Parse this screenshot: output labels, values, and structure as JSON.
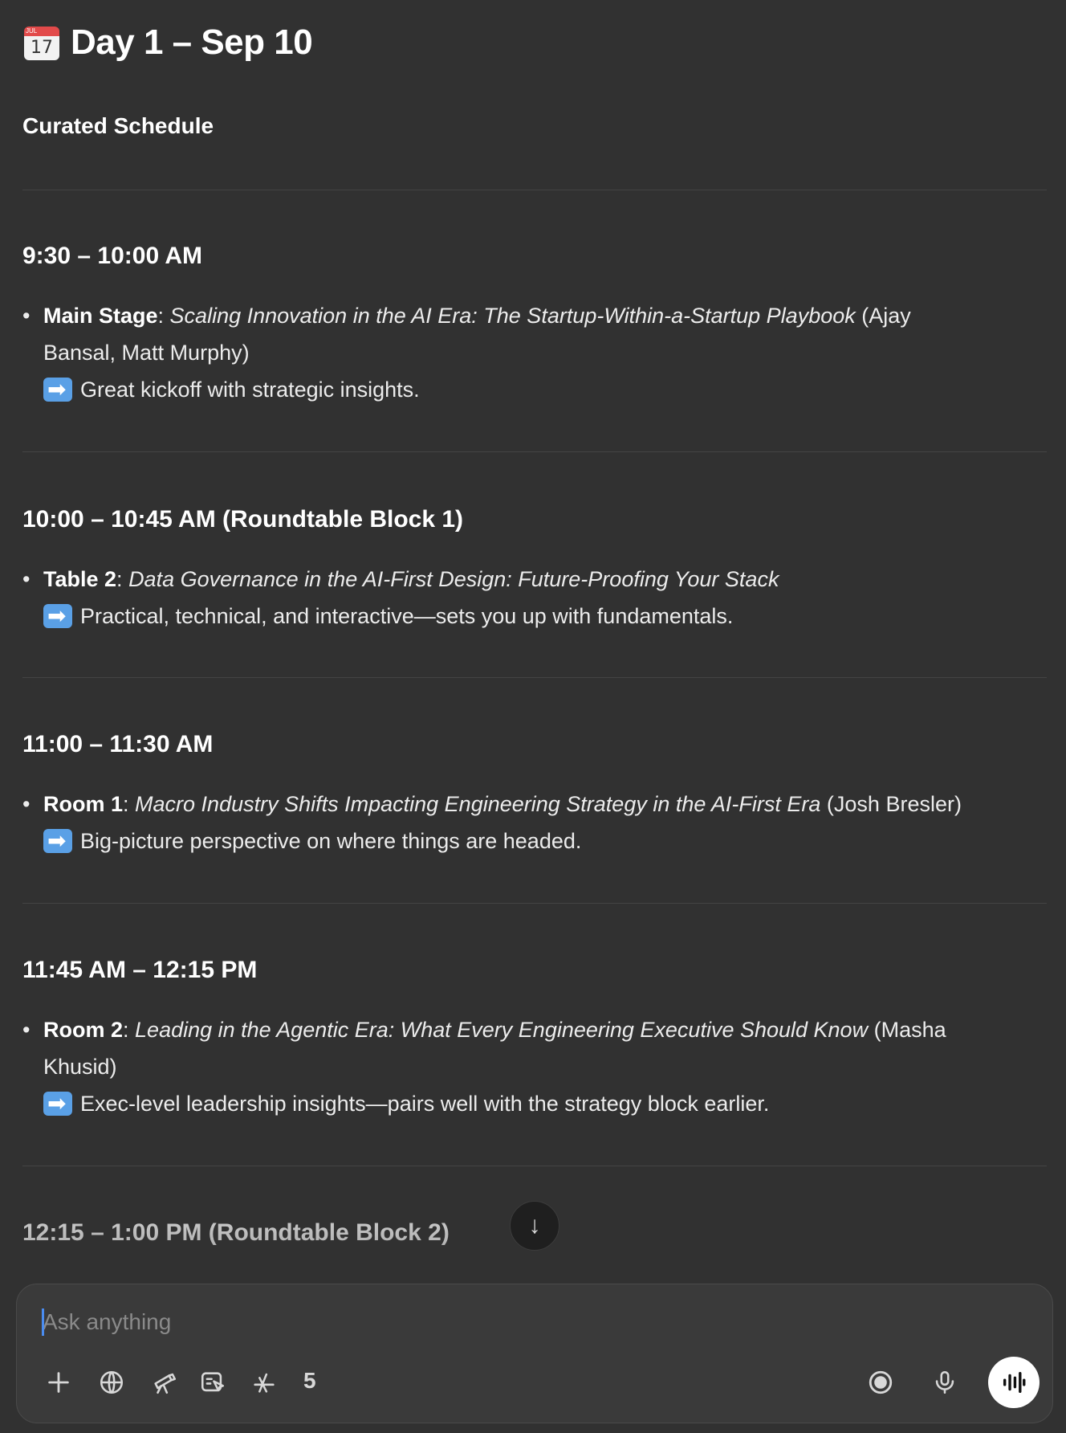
{
  "header": {
    "icon": "calendar-icon",
    "calendar_icon_day": "17",
    "calendar_icon_month": "JUL",
    "title": "Day 1 – Sep 10",
    "subtitle": "Curated Schedule"
  },
  "sessions": [
    {
      "time": "9:30 – 10:00 AM",
      "location": "Main Stage",
      "talk": "Scaling Innovation in the AI Era: The Startup-Within-a-Startup Playbook",
      "speakers_line1": "(Ajay",
      "speakers_line2": "Bansal, Matt Murphy)",
      "note": "Great kickoff with strategic insights."
    },
    {
      "time": "10:00 – 10:45 AM (Roundtable Block 1)",
      "location": "Table 2",
      "talk": "Data Governance in the AI-First Design: Future-Proofing Your Stack",
      "note": "Practical, technical, and interactive—sets you up with fundamentals."
    },
    {
      "time": "11:00 – 11:30 AM",
      "location": "Room 1",
      "talk": "Macro Industry Shifts Impacting Engineering Strategy in the AI-First Era",
      "speakers": "(Josh Bresler)",
      "note": "Big-picture perspective on where things are headed."
    },
    {
      "time": "11:45 AM – 12:15 PM",
      "location": "Room 2",
      "talk": "Leading in the Agentic Era: What Every Engineering Executive Should Know",
      "speakers_line1": "(Masha",
      "speakers_line2": "Khusid)",
      "note": "Exec-level leadership insights—pairs well with the strategy block earlier."
    },
    {
      "time": "12:15 – 1:00 PM (Roundtable Block 2)"
    }
  ],
  "composer": {
    "placeholder": "Ask anything",
    "tool_count": "5",
    "tools": [
      "plus-icon",
      "globe-icon",
      "telescope-icon",
      "canvas-icon",
      "apps-icon"
    ],
    "right_icons": [
      "record-icon",
      "microphone-icon",
      "voice-mode-icon"
    ]
  },
  "colors": {
    "background": "#313131",
    "composer": "#3a3a3a",
    "arrow_emoji": "#5aa0e6",
    "caret": "#4a8cf0"
  }
}
